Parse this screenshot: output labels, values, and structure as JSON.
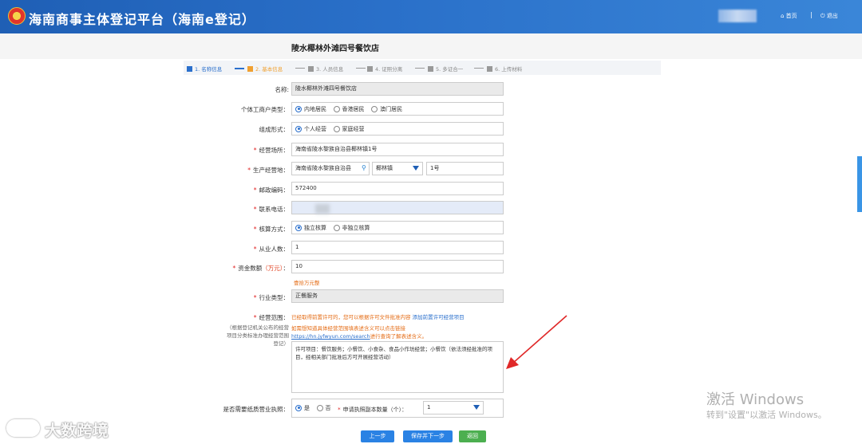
{
  "header": {
    "title": "海南商事主体登记平台（海南e登记）",
    "home": "首页",
    "separator": "|",
    "logout": "退出"
  },
  "page_title": "陵水椰林外滩四号餐饮店",
  "steps": [
    {
      "label": "1. 名称信息",
      "state": "done"
    },
    {
      "label": "2. 基本信息",
      "state": "active"
    },
    {
      "label": "3. 人员信息",
      "state": "todo"
    },
    {
      "label": "4. 证照分离",
      "state": "todo"
    },
    {
      "label": "5. 多证合一",
      "state": "todo"
    },
    {
      "label": "6. 上传材料",
      "state": "todo"
    }
  ],
  "form": {
    "name": {
      "label": "名称:",
      "value": "陵水椰林外滩四号餐饮店"
    },
    "owner_type": {
      "label": "个体工商户类型：",
      "options": [
        "内地居民",
        "香港居民",
        "澳门居民"
      ],
      "selected": 0
    },
    "org_form": {
      "label": "组成形式：",
      "options": [
        "个人经营",
        "家庭经营"
      ],
      "selected": 0
    },
    "biz_address": {
      "label": "经营场所：",
      "value": "海南省陵水黎族自治县椰林镇1号"
    },
    "prod_address": {
      "label": "生产经营地：",
      "county": "海南省陵水黎族自治县",
      "town": "椰林镇",
      "detail": "1号"
    },
    "postcode": {
      "label": "邮政编码：",
      "value": "572400"
    },
    "phone": {
      "label": "联系电话："
    },
    "accounting": {
      "label": "核算方式：",
      "options": [
        "独立核算",
        "非独立核算"
      ],
      "selected": 0
    },
    "employees": {
      "label": "从业人数：",
      "value": "1"
    },
    "capital": {
      "label": "资金数额",
      "unit": "（万元）",
      "colon": "：",
      "value": "10",
      "hint": "壹拾万元整"
    },
    "industry": {
      "label": "行业类型：",
      "value": "正餐服务"
    },
    "scope": {
      "label": "经营范围：",
      "side_hint": "（根据登记机关公布的经营项目分类标准办理经营范围登记）",
      "note1": "已经取得前置许可的，您可以根据许可文件批准内容",
      "note1_link": "添加前置许可经营项目",
      "note2": "如需想知道具体经营范围填表述含义可以点击链接",
      "note3_link": "https://hn.jyfwyun.com/search",
      "note3": "进行查询了解表述含义。",
      "content": "许可项目：餐饮服务；小餐饮、小食杂、食品小作坊经营；小餐饮（依法须经批准的项目，经相关部门批准后方可开展经营活动）"
    },
    "paper_license": {
      "label": "是否需要纸质营业执照：",
      "options": [
        "是",
        "否"
      ],
      "selected": 0,
      "copies_label": "申请执照副本数量（个）：",
      "copies": "1"
    }
  },
  "buttons": {
    "prev": "上一步",
    "save_next": "保存并下一步",
    "back": "返回"
  },
  "windows_activation": {
    "title": "激活 Windows",
    "subtitle": "转到\"设置\"以激活 Windows。"
  },
  "watermark": "大数跨境",
  "colors": {
    "header_blue": "#2a70c9",
    "accent_blue": "#2a82e4",
    "active_step": "#f0a030",
    "required": "#e02020",
    "arrow": "#e02828"
  }
}
